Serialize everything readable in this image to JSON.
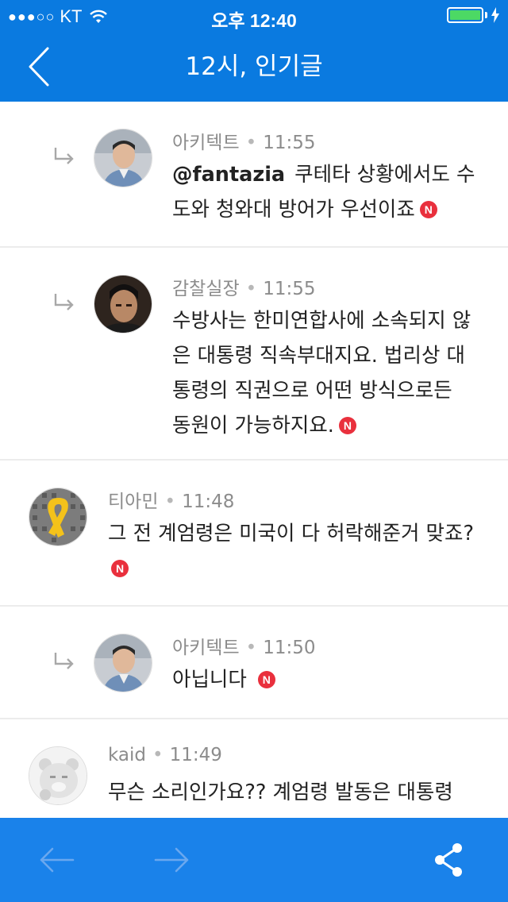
{
  "status_bar": {
    "signal": "●●●○○",
    "carrier": "KT",
    "time": "오후 12:40"
  },
  "header": {
    "title": "12시, 인기글",
    "back_icon": "chevron-left-icon"
  },
  "comments": [
    {
      "author": "아키텍트",
      "time": "11:55",
      "mention": "@fantazia",
      "lines": [
        "쿠테타 상황에서도 수",
        "도와 청와대 방어가 우선이죠"
      ],
      "badge": "N",
      "reply": true
    },
    {
      "author": "감찰실장",
      "time": "11:55",
      "lines": [
        "수방사는 한미연합사에 소속되지 않",
        "은 대통령 직속부대지요. 법리상 대",
        "통령의 직권으로 어떤 방식으로든",
        "동원이 가능하지요."
      ],
      "badge": "N",
      "reply": true
    },
    {
      "author": "티아민",
      "time": "11:48",
      "lines": [
        "그 전 계엄령은 미국이 다 허락해준거 맞죠?"
      ],
      "badge": "N",
      "reply": false
    },
    {
      "author": "아키텍트",
      "time": "11:50",
      "lines": [
        "아닙니다"
      ],
      "badge": "N",
      "reply": true
    },
    {
      "author": "kaid",
      "time": "11:49",
      "lines": [
        "무슨 소리인가요?? 계엄령 발동은 대통령"
      ],
      "reply": false
    }
  ],
  "toolbar": {
    "prev_icon": "arrow-left-icon",
    "next_icon": "arrow-right-icon",
    "share_icon": "share-icon"
  },
  "colors": {
    "header_bg": "#0a7ae0",
    "toolbar_bg": "#1a82ea",
    "badge": "#e9303d"
  }
}
